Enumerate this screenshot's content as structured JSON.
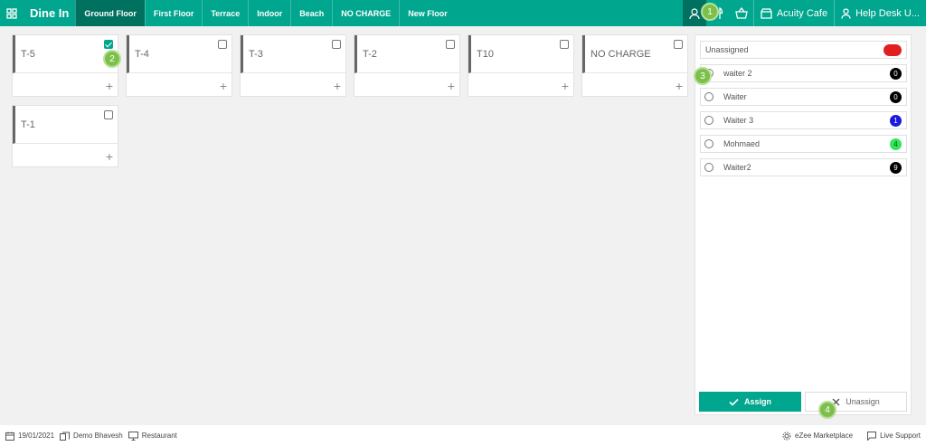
{
  "header": {
    "title": "Dine In",
    "tabs": [
      {
        "label": "Ground Floor",
        "active": true
      },
      {
        "label": "First Floor",
        "active": false
      },
      {
        "label": "Terrace",
        "active": false
      },
      {
        "label": "Indoor",
        "active": false
      },
      {
        "label": "Beach",
        "active": false
      },
      {
        "label": "NO CHARGE",
        "active": false
      },
      {
        "label": "New Floor",
        "active": false
      }
    ],
    "outlet": "Acuity Cafe",
    "user": "Help Desk U..."
  },
  "tables": [
    {
      "name": "T-5",
      "checked": true
    },
    {
      "name": "T-4",
      "checked": false
    },
    {
      "name": "T-3",
      "checked": false
    },
    {
      "name": "T-2",
      "checked": false
    },
    {
      "name": "T10",
      "checked": false
    },
    {
      "name": "NO CHARGE",
      "checked": false
    },
    {
      "name": "T-1",
      "checked": false
    }
  ],
  "waiters": [
    {
      "name": "Unassigned",
      "count": "",
      "color": "#e02020",
      "text_color": "#ffffff",
      "radio": false
    },
    {
      "name": "waiter 2",
      "count": "0",
      "color": "#000000",
      "text_color": "#ffffff",
      "radio": true
    },
    {
      "name": "Waiter",
      "count": "0",
      "color": "#000000",
      "text_color": "#ffffff",
      "radio": true
    },
    {
      "name": "Waiter 3",
      "count": "1",
      "color": "#1a1adf",
      "text_color": "#ffffff",
      "radio": true
    },
    {
      "name": "Mohmaed",
      "count": "4",
      "color": "#2ee85a",
      "text_color": "#333333",
      "radio": true
    },
    {
      "name": "Waiter2",
      "count": "9",
      "color": "#000000",
      "text_color": "#ffffff",
      "radio": true
    }
  ],
  "buttons": {
    "assign": "Assign",
    "unassign": "Unassign"
  },
  "markers": [
    "1",
    "2",
    "3",
    "4"
  ],
  "footer": {
    "date": "19/01/2021",
    "user": "Demo Bhavesh",
    "mode": "Restaurant",
    "marketplace": "eZee Marketplace",
    "support": "Live Support"
  },
  "colors": {
    "accent": "#00a68e",
    "accent_dark": "#00705f",
    "marker": "#7cbf4a"
  }
}
